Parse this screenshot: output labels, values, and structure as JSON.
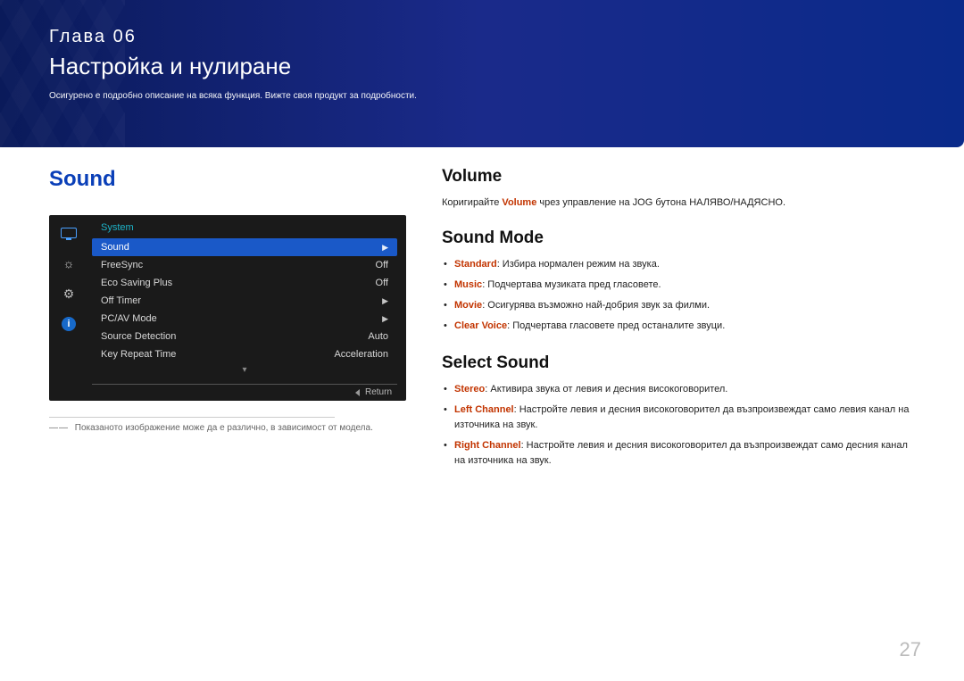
{
  "banner": {
    "chapter": "Глава  06",
    "title": "Настройка и нулиране",
    "sub": "Осигурено е подробно описание на всяка функция. Вижте своя продукт за подробности."
  },
  "left": {
    "heading": "Sound",
    "osd": {
      "title": "System",
      "rows": [
        {
          "label": "Sound",
          "value": "▶",
          "selected": true
        },
        {
          "label": "FreeSync",
          "value": "Off"
        },
        {
          "label": "Eco Saving Plus",
          "value": "Off"
        },
        {
          "label": "Off Timer",
          "value": "▶"
        },
        {
          "label": "PC/AV Mode",
          "value": "▶"
        },
        {
          "label": "Source Detection",
          "value": "Auto"
        },
        {
          "label": "Key Repeat Time",
          "value": "Acceleration"
        }
      ],
      "return": "Return"
    },
    "footnote": "Показаното изображение може да е различно, в зависимост от модела."
  },
  "right": {
    "volume": {
      "heading": "Volume",
      "text_before": "Коригирайте ",
      "text_hl": "Volume",
      "text_after": " чрез управление на JOG бутона НАЛЯВО/НАДЯСНО."
    },
    "sound_mode": {
      "heading": "Sound Mode",
      "items": [
        {
          "hl": "Standard",
          "rest": ": Избира нормален режим на звука."
        },
        {
          "hl": "Music",
          "rest": ": Подчертава музиката пред гласовете."
        },
        {
          "hl": "Movie",
          "rest": ": Осигурява възможно най-добрия звук за филми."
        },
        {
          "hl": "Clear Voice",
          "rest": ": Подчертава гласовете пред останалите звуци."
        }
      ]
    },
    "select_sound": {
      "heading": "Select Sound",
      "items": [
        {
          "hl": "Stereo",
          "rest": ": Активира звука от левия и десния високоговорител."
        },
        {
          "hl": "Left Channel",
          "rest": ": Настройте левия и десния високоговорител да възпроизвеждат само левия канал на източника на звук."
        },
        {
          "hl": "Right Channel",
          "rest": ": Настройте левия и десния високоговорител да възпроизвеждат само десния канал на източника на звук."
        }
      ]
    }
  },
  "page_number": "27"
}
